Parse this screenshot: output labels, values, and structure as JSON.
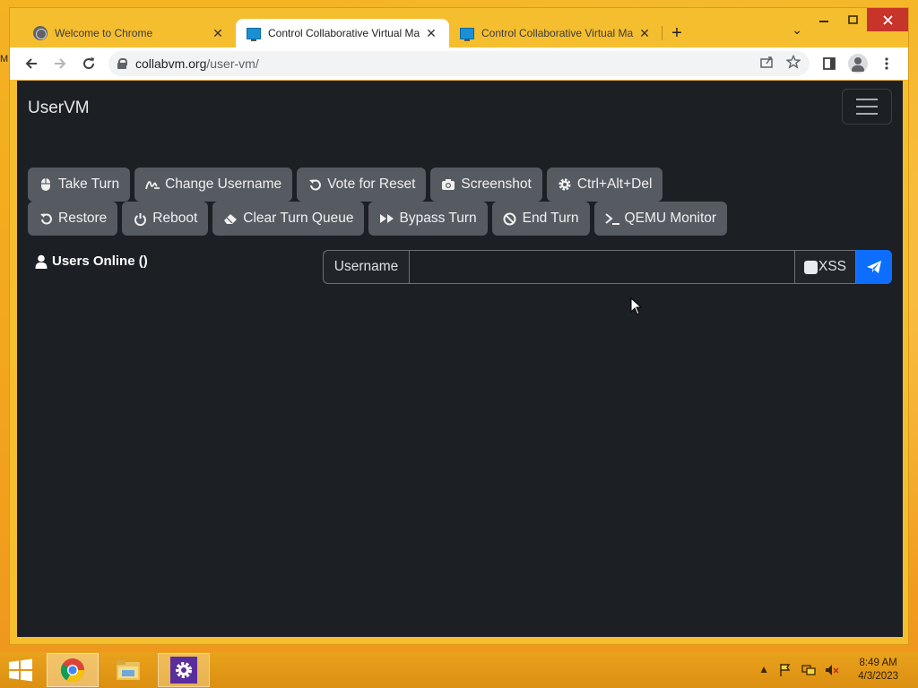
{
  "desktop": {
    "edge_label": "M"
  },
  "browser": {
    "tabs": [
      {
        "title": "Welcome to Chrome",
        "favicon": "globe-icon",
        "active": false
      },
      {
        "title": "Control Collaborative Virtual Ma",
        "favicon": "monitor-icon",
        "active": true
      },
      {
        "title": "Control Collaborative Virtual Ma",
        "favicon": "monitor-icon",
        "active": false
      }
    ],
    "url_host": "collabvm.org",
    "url_path": "/user-vm/"
  },
  "page": {
    "brand": "UserVM",
    "buttons_row1": [
      {
        "label": "Take Turn",
        "icon": "mouse-icon"
      },
      {
        "label": "Change Username",
        "icon": "signature-icon"
      },
      {
        "label": "Vote for Reset",
        "icon": "rotate-left-icon"
      },
      {
        "label": "Screenshot",
        "icon": "camera-icon"
      },
      {
        "label": "Ctrl+Alt+Del",
        "icon": "gear-icon"
      }
    ],
    "buttons_row2": [
      {
        "label": "Restore",
        "icon": "rotate-left-icon"
      },
      {
        "label": "Reboot",
        "icon": "power-icon"
      },
      {
        "label": "Clear Turn Queue",
        "icon": "eraser-icon"
      },
      {
        "label": "Bypass Turn",
        "icon": "forward-icon"
      },
      {
        "label": "End Turn",
        "icon": "ban-icon"
      },
      {
        "label": "QEMU Monitor",
        "icon": "terminal-icon"
      }
    ],
    "users_online": "Users Online ()",
    "chat": {
      "username_label": "Username",
      "input_value": "",
      "xss_label": "XSS",
      "xss_checked": false
    }
  },
  "taskbar": {
    "clock_time": "8:49 AM",
    "clock_date": "4/3/2023"
  },
  "colors": {
    "page_bg": "#1c1f24",
    "button_bg": "#565b62",
    "send_button": "#0d6efd",
    "desktop": "#f3a51f"
  }
}
